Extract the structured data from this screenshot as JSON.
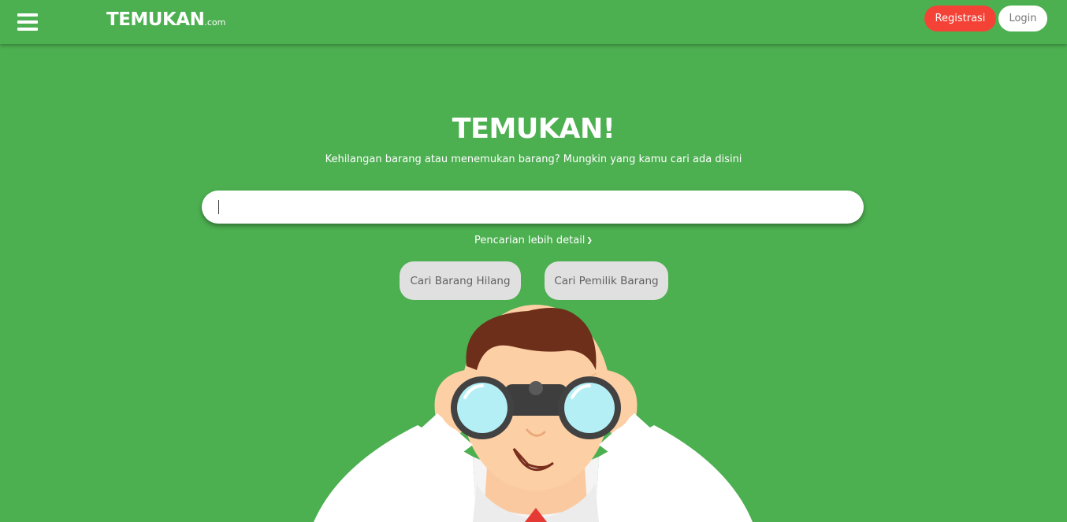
{
  "navbar": {
    "menu_icon": "hamburger-menu-icon",
    "brand_main": "TEMUKAN",
    "brand_suffix": ".com",
    "register_label": "Registrasi",
    "login_label": "Login"
  },
  "hero": {
    "title": "TEMUKAN!",
    "subtitle": "Kehilangan barang atau menemukan barang? Mungkin yang kamu cari ada disini",
    "search": {
      "value": "",
      "placeholder": ""
    },
    "detail_label": "Pencarian lebih detail",
    "detail_icon": "chevron-down-icon",
    "chips": {
      "lost": "Cari Barang Hilang",
      "owner": "Cari Pemilik Barang"
    }
  },
  "colors": {
    "background": "#4caf50",
    "register_button": "#f44336",
    "login_button": "#ffffff",
    "chip": "#e0e0e0"
  }
}
